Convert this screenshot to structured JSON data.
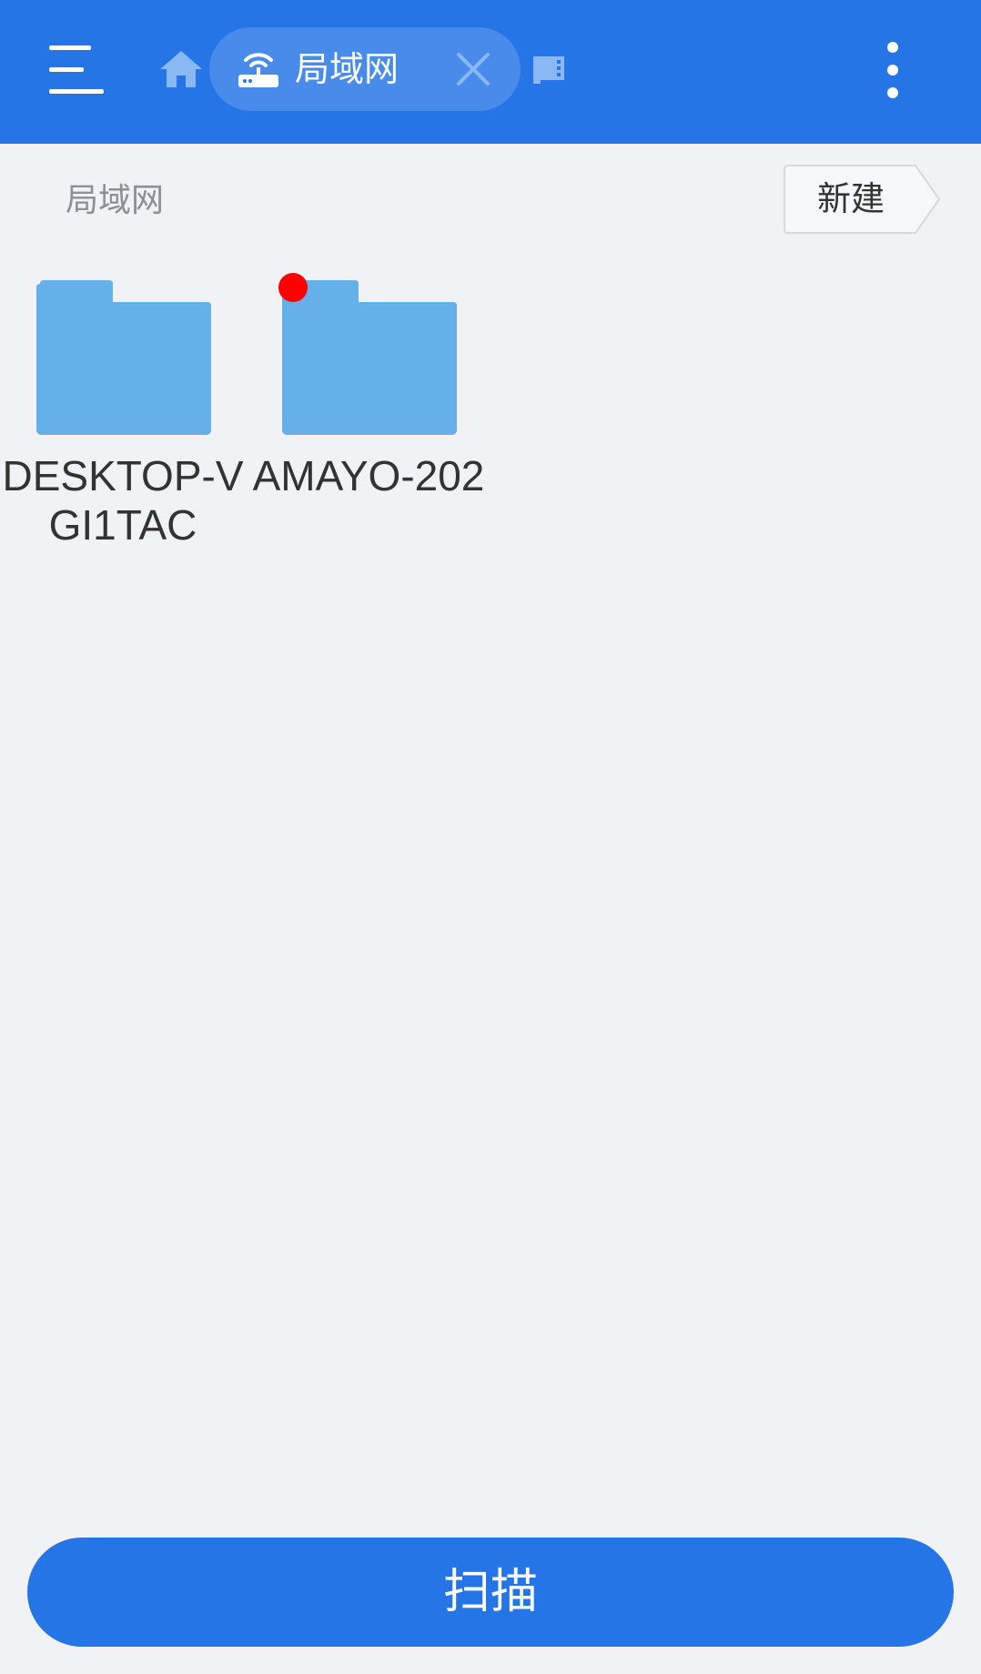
{
  "header": {
    "tab_label": "局域网",
    "colors": {
      "bar": "#2575e6",
      "icon": "#ffffff",
      "muted_icon": "#8ab8f5"
    },
    "icons": [
      "menu-icon",
      "home-icon",
      "router-icon",
      "close-icon",
      "storage-icon",
      "more-vert-icon"
    ]
  },
  "path": {
    "label": "局域网",
    "new_button_label": "新建"
  },
  "folders": [
    {
      "name": "DESKTOP-VGI1TAC",
      "badge": false
    },
    {
      "name": "AMAYO-202",
      "badge": true
    }
  ],
  "footer": {
    "scan_label": "扫描"
  },
  "colors": {
    "background": "#f0f2f5",
    "folder": "#66b0ea",
    "folder_back": "#5ba6e2",
    "badge": "#ff0000",
    "accent": "#2575e6"
  }
}
